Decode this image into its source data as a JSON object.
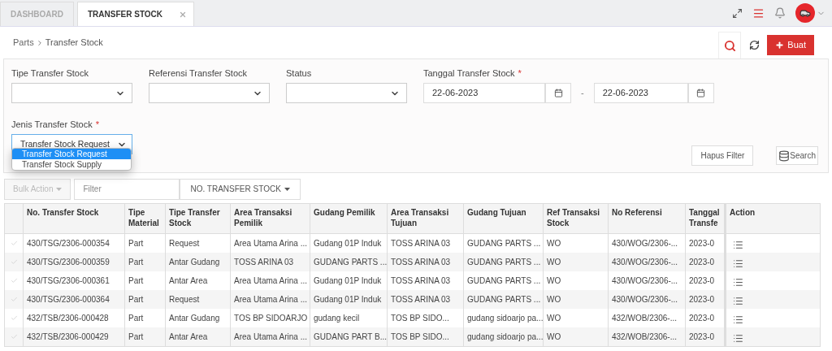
{
  "tabs": [
    {
      "label": "DASHBOARD",
      "selected": false,
      "closable": false
    },
    {
      "label": "TRANSFER STOCK",
      "selected": true,
      "closable": true
    }
  ],
  "breadcrumb": [
    "Parts",
    "Transfer Stock"
  ],
  "actions": {
    "create": "Buat"
  },
  "filters": {
    "fields": [
      {
        "label": "Tipe Transfer Stock"
      },
      {
        "label": "Referensi Transfer Stock"
      },
      {
        "label": "Status"
      }
    ],
    "date": {
      "label": "Tanggal Transfer Stock",
      "required_mark": "*",
      "from": "22-06-2023",
      "separator": "-",
      "to": "22-06-2023"
    },
    "jenis": {
      "label": "Jenis Transfer Stock",
      "required_mark": "*",
      "value": "Transfer Stock Request",
      "options": [
        {
          "label": "Transfer Stock Request",
          "selected": true
        },
        {
          "label": "Transfer Stock Supply",
          "selected": false
        }
      ]
    },
    "clear": "Hapus Filter",
    "search": "Search"
  },
  "toolbar": {
    "bulk_action": {
      "label": "Bulk Action",
      "disabled": true
    },
    "filter_placeholder": "Filter",
    "column_picker": "NO. TRANSFER STOCK"
  },
  "table": {
    "columns": [
      "No. Transfer Stock",
      "Tipe Material",
      "Tipe Transfer Stock",
      "Area Transaksi Pemilik",
      "Gudang Pemilik",
      "Area Transaksi Tujuan",
      "Gudang Tujuan",
      "Ref Transaksi Stock",
      "No Referensi",
      "Tanggal Transfe",
      "Action"
    ],
    "rows": [
      {
        "checked": false,
        "cells": [
          "430/TSG/2306-000354",
          "Part",
          "Request",
          "Area Utama Arina ...",
          "Gudang 01P Induk",
          "TOSS ARINA 03",
          "GUDANG PARTS ...",
          "WO",
          "430/WOG/2306-...",
          "2023-0"
        ]
      },
      {
        "checked": false,
        "cells": [
          "430/TSG/2306-000359",
          "Part",
          "Antar Gudang",
          "TOSS ARINA 03",
          "GUDANG PARTS ...",
          "TOSS ARINA 03",
          "GUDANG PARTS ...",
          "WO",
          "430/WOG/2306-...",
          "2023-0"
        ]
      },
      {
        "checked": false,
        "cells": [
          "430/TSG/2306-000361",
          "Part",
          "Antar Area",
          "Area Utama Arina ...",
          "Gudang 01P Induk",
          "TOSS ARINA 03",
          "GUDANG PARTS ...",
          "WO",
          "430/WOG/2306-...",
          "2023-0"
        ]
      },
      {
        "checked": false,
        "cells": [
          "430/TSG/2306-000364",
          "Part",
          "Request",
          "Area Utama Arina ...",
          "Gudang 01P Induk",
          "TOSS ARINA 03",
          "GUDANG PARTS ...",
          "WO",
          "430/WOG/2306-...",
          "2023-0"
        ]
      },
      {
        "checked": false,
        "cells": [
          "432/TSB/2306-000428",
          "Part",
          "Antar Gudang",
          "TOS BP SIDOARJO",
          "gudang kecil",
          "TOS BP SIDO...",
          "gudang sidoarjo pa...",
          "WO",
          "432/WOB/2306-...",
          "2023-0"
        ]
      },
      {
        "checked": false,
        "cells": [
          "432/TSB/2306-000429",
          "Part",
          "Antar Area",
          "Area Utama Arina ...",
          "GUDANG PART B...",
          "TOS BP SIDO...",
          "gudang sidoarjo pa...",
          "WO",
          "432/WOB/2306-...",
          "2023-0"
        ]
      }
    ]
  }
}
